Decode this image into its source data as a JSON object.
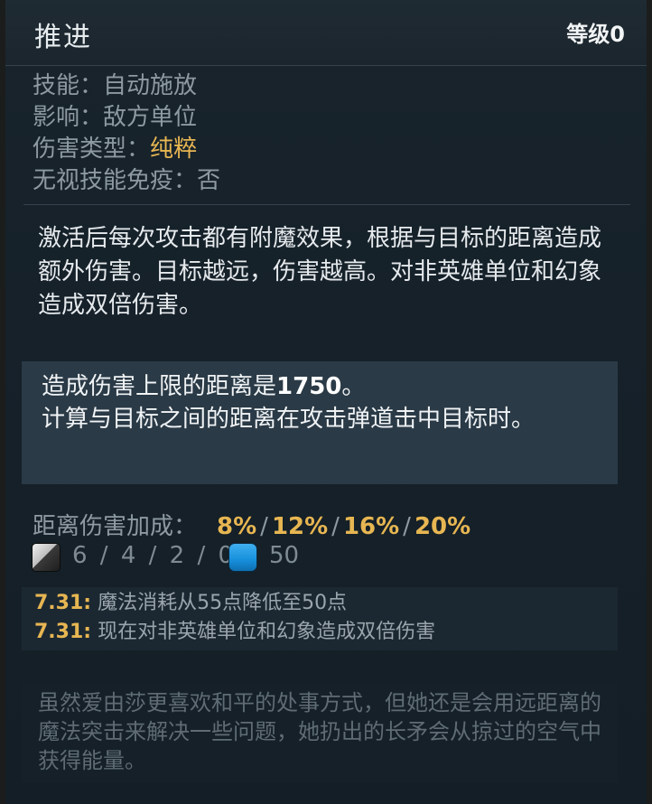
{
  "tooltip": {
    "title": "推进",
    "level": "等级0"
  },
  "properties": [
    {
      "label": "技能：",
      "value": "自动施放"
    },
    {
      "label": "影响：",
      "value": "敌方单位"
    },
    {
      "label": "伤害类型：",
      "value": "纯粹"
    },
    {
      "label": "无视技能免疫：",
      "value": "否"
    }
  ],
  "description": "激活后每次攻击都有附魔效果，根据与目标的距离造成额外伤害。目标越远，伤害越高。对非英雄单位和幻象造成双倍伤害。",
  "note": {
    "line1_prefix": "造成伤害上限的距离是",
    "line1_value": "1750",
    "line1_suffix": "。",
    "line2": "计算与目标之间的距离在攻击弹道击中目标时。"
  },
  "bonus": {
    "label": "距离伤害加成：",
    "values": [
      "8%",
      "12%",
      "16%",
      "20%"
    ],
    "separator": "/"
  },
  "costs": {
    "cooldown_icon": "cooldown-icon",
    "cooldown": "6 / 4 / 2 / 0",
    "mana_icon": "mana-icon",
    "mana": "50"
  },
  "patch_notes": [
    {
      "version": "7.31:",
      "text": " 魔法消耗从55点降低至50点"
    },
    {
      "version": "7.31:",
      "text": " 现在对非英雄单位和幻象造成双倍伤害"
    }
  ],
  "lore": "虽然爱由莎更喜欢和平的处事方式，但她还是会用远距离的魔法突击来解决一些问题，她扔出的长矛会从掠过的空气中获得能量。",
  "colors": {
    "accent": "#e7b652",
    "background": "#16212a",
    "note_bg": "#2a3a46"
  }
}
